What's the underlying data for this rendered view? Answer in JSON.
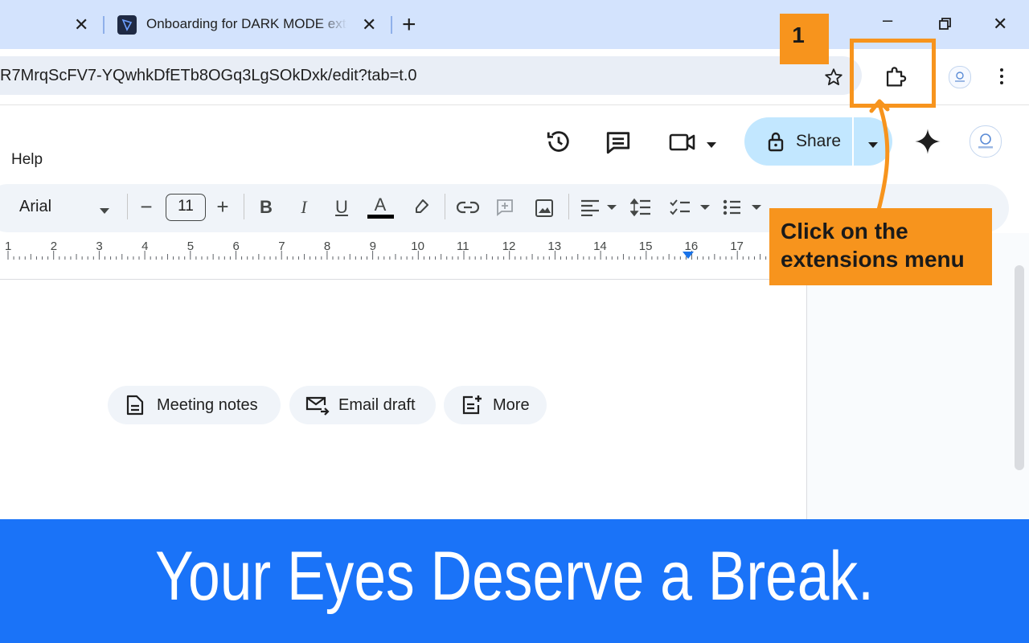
{
  "browser": {
    "active_tab_title": "Onboarding for DARK MODE extension",
    "tab_close_glyph": "✕",
    "new_tab_glyph": "+",
    "url": "R7MrqScFV7-YQwhkDfETb8OGq3LgSOkDxk/edit?tab=t.0",
    "window_controls": {
      "minimize": "–",
      "restore": "❐",
      "close": "✕"
    }
  },
  "docs": {
    "menu": {
      "help": "Help"
    },
    "share_label": "Share",
    "toolbar": {
      "font_name": "Arial",
      "font_size": "11",
      "decrease": "−",
      "increase": "+",
      "bold": "B",
      "italic": "I",
      "underline": "U",
      "text_color": "A"
    },
    "ruler_numbers": [
      "1",
      "2",
      "3",
      "4",
      "5",
      "6",
      "7",
      "8",
      "9",
      "10",
      "11",
      "12",
      "13",
      "14",
      "15",
      "16",
      "17"
    ],
    "chips": [
      {
        "label": "Meeting notes",
        "icon": "document-icon"
      },
      {
        "label": "Email draft",
        "icon": "email-icon"
      },
      {
        "label": "More",
        "icon": "add-note-icon"
      }
    ]
  },
  "annotation": {
    "step_number": "1",
    "callout_text": "Click on the extensions menu",
    "accent_color": "#f7941d"
  },
  "banner": {
    "text": "Your Eyes Deserve a Break.",
    "color": "#1a73f8"
  }
}
